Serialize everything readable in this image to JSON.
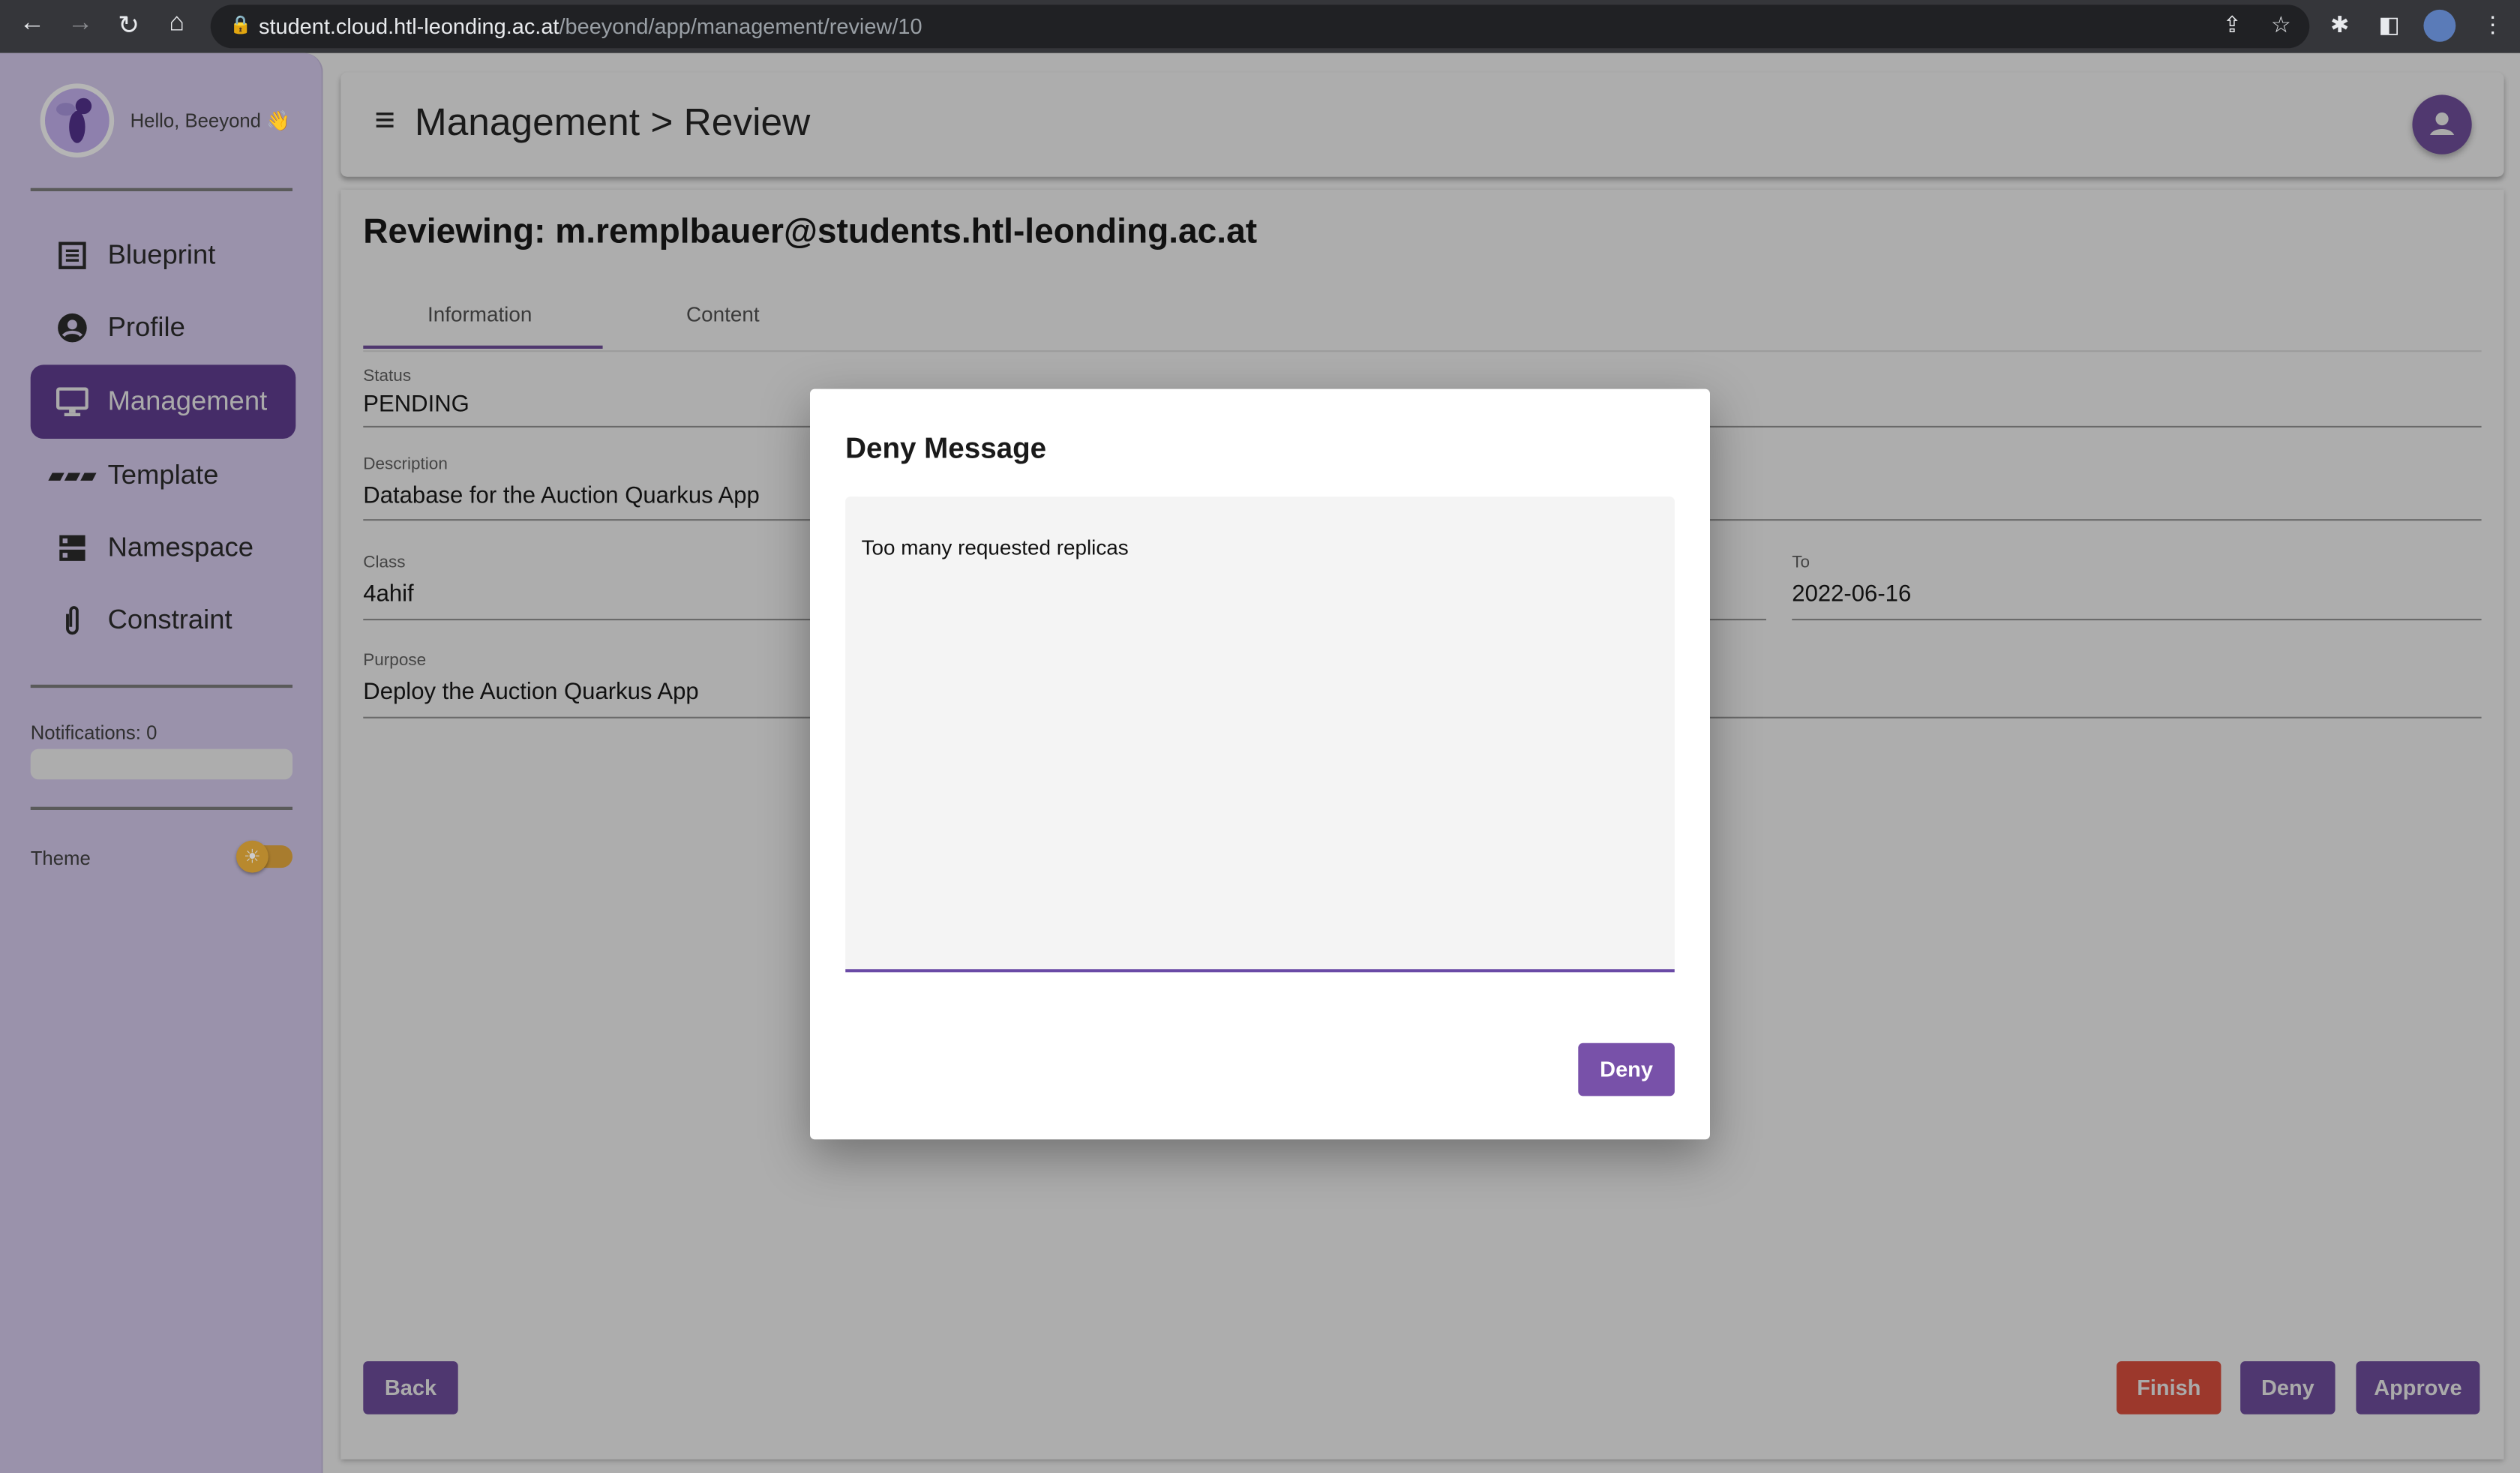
{
  "browser": {
    "url_host": "student.cloud.htl-leonding.ac.at",
    "url_path": "/beeyond/app/management/review/10"
  },
  "sidebar": {
    "greeting": "Hello, Beeyond 👋",
    "items": [
      {
        "label": "Blueprint",
        "icon": "list-alt-icon"
      },
      {
        "label": "Profile",
        "icon": "account-circle-icon"
      },
      {
        "label": "Management",
        "icon": "monitor-icon",
        "active": true
      },
      {
        "label": "Template",
        "icon": "template-icon"
      },
      {
        "label": "Namespace",
        "icon": "storage-icon"
      },
      {
        "label": "Constraint",
        "icon": "paperclip-icon"
      }
    ],
    "notifications": "Notifications: 0",
    "theme_label": "Theme"
  },
  "header": {
    "title": "Management > Review"
  },
  "page": {
    "title": "Reviewing: m.remplbauer@students.htl-leonding.ac.at",
    "tabs": [
      {
        "label": "Information",
        "active": true
      },
      {
        "label": "Content"
      }
    ],
    "fields": {
      "status": {
        "label": "Status",
        "value": "PENDING"
      },
      "description": {
        "label": "Description",
        "value": "Database for the Auction Quarkus App"
      },
      "class": {
        "label": "Class",
        "value": "4ahif"
      },
      "to": {
        "label": "To",
        "value": "2022-06-16"
      },
      "purpose": {
        "label": "Purpose",
        "value": "Deploy the Auction Quarkus App"
      }
    },
    "buttons": {
      "back": "Back",
      "finish": "Finish",
      "deny": "Deny",
      "approve": "Approve"
    }
  },
  "dialog": {
    "title": "Deny Message",
    "message": "Too many requested replicas",
    "deny_label": "Deny"
  },
  "colors": {
    "primary": "#7851a9",
    "finish": "#9c382c",
    "sidebar_active": "#452c68"
  }
}
